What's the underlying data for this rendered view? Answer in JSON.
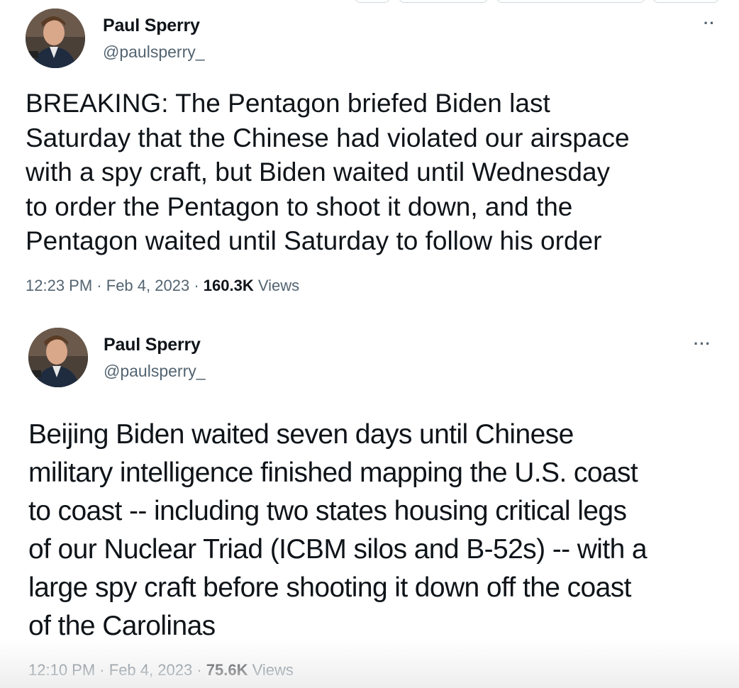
{
  "tweets": [
    {
      "name": "Paul Sperry",
      "handle": "@paulsperry_",
      "more": "··",
      "text": "BREAKING: The Pentagon briefed Biden last\nSaturday that the Chinese had violated our airspace\nwith a spy craft, but Biden waited until Wednesday\nto order the Pentagon to shoot it down, and the\nPentagon waited until Saturday to follow his order",
      "time": "12:23 PM",
      "date": "Feb 4, 2023",
      "views_count": "160.3K",
      "views_label": "Views",
      "sep": "·"
    },
    {
      "name": "Paul Sperry",
      "handle": "@paulsperry_",
      "more": "···",
      "text": "Beijing Biden waited seven days until Chinese\nmilitary intelligence finished mapping the U.S. coast\nto coast -- including two states housing critical legs\nof our Nuclear Triad (ICBM silos and B-52s) -- with a\nlarge spy craft before shooting it down off the coast\nof the Carolinas",
      "time": "12:10 PM",
      "date": "Feb 4, 2023",
      "views_count": "75.6K",
      "views_label": "Views",
      "sep": "·"
    }
  ]
}
